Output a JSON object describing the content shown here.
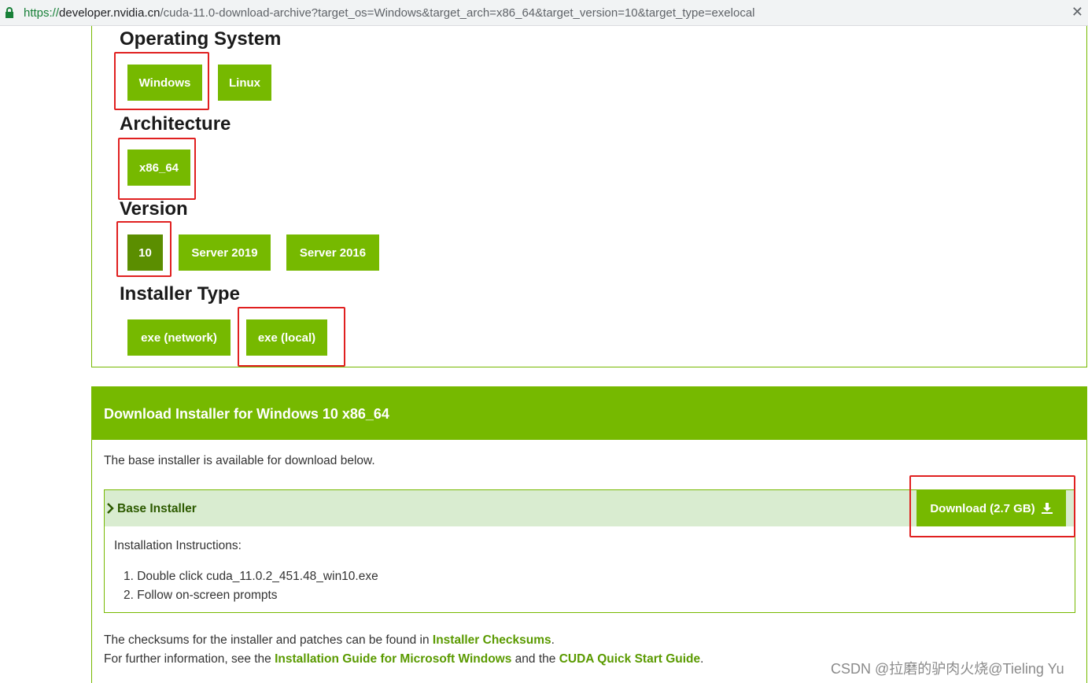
{
  "address_bar": {
    "protocol": "https://",
    "host": "developer.nvidia.cn",
    "path": "/cuda-11.0-download-archive?target_os=Windows&target_arch=x86_64&target_version=10&target_type=exelocal"
  },
  "selector": {
    "os": {
      "title": "Operating System",
      "options": [
        "Windows",
        "Linux"
      ],
      "selected": "Windows"
    },
    "arch": {
      "title": "Architecture",
      "options": [
        "x86_64"
      ],
      "selected": "x86_64"
    },
    "version": {
      "title": "Version",
      "options": [
        "10",
        "Server 2019",
        "Server 2016"
      ],
      "selected": "10"
    },
    "installer": {
      "title": "Installer Type",
      "options": [
        "exe (network)",
        "exe (local)"
      ],
      "selected": "exe (local)"
    }
  },
  "download": {
    "header": "Download Installer for Windows 10 x86_64",
    "intro": "The base installer is available for download below.",
    "base_installer_label": "Base Installer",
    "download_button": "Download (2.7 GB)",
    "instructions_title": "Installation Instructions:",
    "steps": [
      "Double click cuda_11.0.2_451.48_win10.exe",
      "Follow on-screen prompts"
    ],
    "checksum_text_pre": "The checksums for the installer and patches can be found in ",
    "checksum_link": "Installer Checksums",
    "checksum_text_post": ".",
    "further_pre": "For further information, see the ",
    "guide_link": "Installation Guide for Microsoft Windows",
    "further_mid": " and the ",
    "quickstart_link": "CUDA Quick Start Guide",
    "further_post": "."
  },
  "watermark": "CSDN @拉磨的驴肉火烧@Tieling Yu",
  "colors": {
    "accent": "#76b900",
    "accent_dark": "#5b8e00",
    "highlight": "#e02020"
  }
}
